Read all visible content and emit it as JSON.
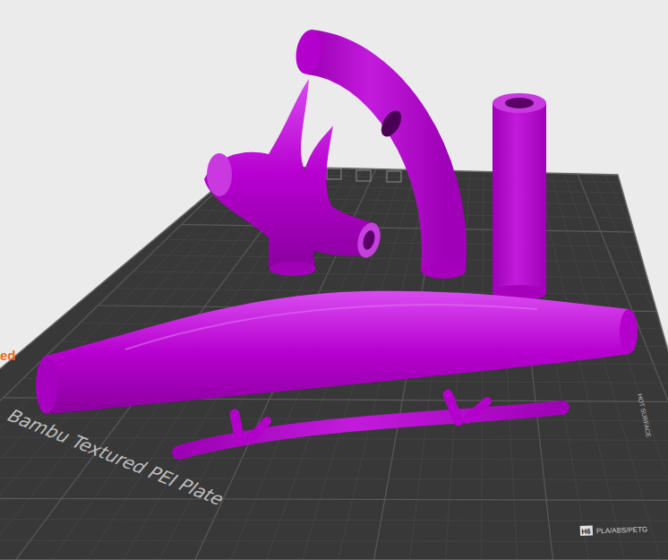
{
  "viewport": {
    "plate": {
      "name": "Bambu Textured PEI Plate",
      "logo": "ed",
      "badge": "H6",
      "filament": "PLA/ABS/PETG",
      "warning": "HOT SURFACE"
    }
  }
}
